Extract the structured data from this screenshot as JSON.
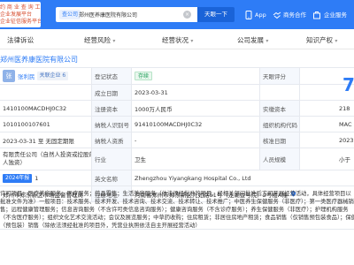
{
  "header": {
    "logo_lines": [
      "约 商 业 查 询 工 具",
      "企业发展平台",
      "企业征信服务平台"
    ],
    "search_tag": "查公司",
    "search_value": "郑州医养康医院有限公司",
    "search_button": "天眼一下",
    "links": [
      "App",
      "商务合作",
      "企业服务"
    ],
    "accent": "#2e7cf6"
  },
  "tabs": [
    {
      "label": "法律诉讼",
      "dropdown": true
    },
    {
      "label": "经营风险",
      "dropdown": true
    },
    {
      "label": "经营状况",
      "dropdown": true
    },
    {
      "label": "公司发展",
      "dropdown": true
    },
    {
      "label": "知识产权",
      "dropdown": true
    }
  ],
  "company_name": "郑州医养康医院有限公司",
  "rows": {
    "r1": {
      "avatar": "张",
      "person": "张利民",
      "badge": "关联企业 6",
      "label1": "登记状态",
      "status": "存续",
      "label2": "天眼评分",
      "score": "7"
    },
    "r2": {
      "label1": "成立日期",
      "value1": "2023-03-31"
    },
    "r3": {
      "left": "1410100MACDHJ0C32",
      "label1": "注册资本",
      "value1": "1000万人民币",
      "label2": "实缴资本",
      "value2": "218"
    },
    "r4": {
      "left": "1010100107601",
      "label1": "纳税人识别号",
      "value1": "91410100MACDHJ0C32",
      "label2": "组织机构代码",
      "value2": "MAC"
    },
    "r5": {
      "left": "2023-03-31 至 无固定期限",
      "label1": "纳税人资质",
      "value1": "-",
      "label2": "核准日期",
      "value2": "2023"
    },
    "r6": {
      "left_line1": "有限责任公司（自然人投资或控股的法",
      "left_line2": "人独资）",
      "label1": "行业",
      "value1": "卫生",
      "label2": "人员规模",
      "value2": "小于"
    },
    "r7": {
      "badge": "2024年报",
      "left": "1",
      "label1": "英文名称",
      "value1": "Zhengzhou Yiyangkang Hospital Co., Ltd"
    },
    "r8": {
      "left": "郑州市郑东新区市场监督管理局",
      "label1": "注册地址",
      "value1": "河南省郑州市郑东新区九如路51号（龙湖壹号院）2号楼A幢"
    }
  },
  "scope_lines": [
    "许可项目：医疗美容服务；医疗服务；药品零售；生活美容服务（依法须经批准的项目，经相关部门批准后方可开展经营活动，具体经营项目以",
    "批准文件为准）一般项目：技术服务、技术开发、技术咨询、技术交流、技术转让、技术推广；中医养生保健服务（非医疗）；第一类医疗器械销",
    "售；远程健康管理服务；信息咨询服务（不含许可类信息咨询服务）；健康咨询服务（不含诊疗服务）；养生保健服务（非医疗）；护理机构服务",
    "（不含医疗服务）；组织文化艺术交流活动；会议及展览服务；中草药收购；住房租赁；非居住房地产租赁；食品销售（仅销售预包装食品）；保健食品",
    "（预包装）销售（除依法须经批准的项目外，凭营业执照依法自主开展经营活动）"
  ]
}
